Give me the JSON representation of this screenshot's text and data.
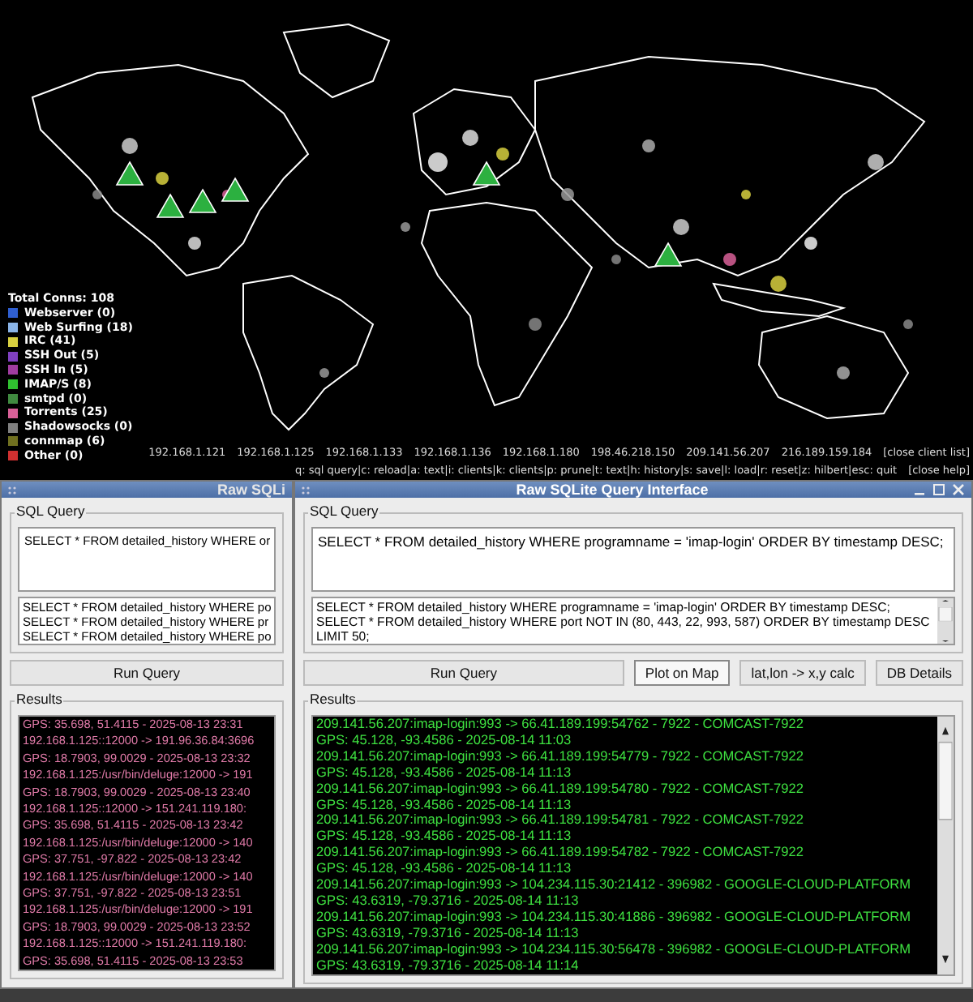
{
  "map": {
    "legend": {
      "total": "Total Conns: 108",
      "items": [
        {
          "label": "Webserver (0)",
          "color": "#2f5fd0"
        },
        {
          "label": "Web Surfing (18)",
          "color": "#8ab4e8"
        },
        {
          "label": "IRC (41)",
          "color": "#d8d040"
        },
        {
          "label": "SSH Out (5)",
          "color": "#8040c0"
        },
        {
          "label": "SSH In (5)",
          "color": "#a03ca0"
        },
        {
          "label": "IMAP/S (8)",
          "color": "#30c030"
        },
        {
          "label": "smtpd (0)",
          "color": "#408a40"
        },
        {
          "label": "Torrents (25)",
          "color": "#d86098"
        },
        {
          "label": "Shadowsocks (0)",
          "color": "#808080"
        },
        {
          "label": "connmap (6)",
          "color": "#707020"
        },
        {
          "label": "Other (0)",
          "color": "#d03030"
        }
      ]
    },
    "client_list": {
      "clients": [
        "192.168.1.121",
        "192.168.1.125",
        "192.168.1.133",
        "192.168.1.136",
        "192.168.1.180",
        "198.46.218.150",
        "209.141.56.207",
        "216.189.159.184"
      ],
      "close": "[close client list]"
    },
    "help_bar": {
      "text": "q: sql query|c: reload|a: text|i: clients|k: clients|p: prune|t: text|h: history|s: save|l: load|r: reset|z: hilbert|esc: quit",
      "close": "[close help]"
    }
  },
  "windows": [
    {
      "title": "Raw SQLi",
      "query_label": "SQL Query",
      "query": "SELECT * FROM detailed_history WHERE or",
      "history": [
        "SELECT * FROM detailed_history WHERE po",
        "SELECT * FROM detailed_history WHERE pr",
        "SELECT * FROM detailed_history WHERE po"
      ],
      "buttons": [
        {
          "label": "Run Query",
          "selected": false
        }
      ],
      "results_label": "Results",
      "results": [
        "GPS: 35.698, 51.4115 - 2025-08-13 23:31",
        "192.168.1.125::12000 -> 191.96.36.84:3696",
        "GPS: 18.7903, 99.0029 - 2025-08-13 23:32",
        "192.168.1.125:/usr/bin/deluge:12000 -> 191",
        "GPS: 18.7903, 99.0029 - 2025-08-13 23:40",
        "192.168.1.125::12000 -> 151.241.119.180:",
        "GPS: 35.698, 51.4115 - 2025-08-13 23:42",
        "192.168.1.125:/usr/bin/deluge:12000 -> 140",
        "GPS: 37.751, -97.822 - 2025-08-13 23:42",
        "192.168.1.125:/usr/bin/deluge:12000 -> 140",
        "GPS: 37.751, -97.822 - 2025-08-13 23:51",
        "192.168.1.125:/usr/bin/deluge:12000 -> 191",
        "GPS: 18.7903, 99.0029 - 2025-08-13 23:52",
        "192.168.1.125::12000 -> 151.241.119.180:",
        "GPS: 35.698, 51.4115 - 2025-08-13 23:53"
      ]
    },
    {
      "title": "Raw SQLite Query Interface",
      "query_label": "SQL Query",
      "query": "SELECT * FROM detailed_history WHERE programname = 'imap-login' ORDER BY timestamp DESC;",
      "history": [
        "SELECT * FROM detailed_history WHERE programname = 'imap-login' ORDER BY timestamp DESC;",
        "SELECT * FROM detailed_history WHERE port NOT IN (80, 443, 22, 993, 587) ORDER BY timestamp DESC LIMIT 50;"
      ],
      "buttons": [
        {
          "label": "Run Query",
          "selected": false
        },
        {
          "label": "Plot on Map",
          "selected": true
        },
        {
          "label": "lat,lon -> x,y calc",
          "selected": false
        },
        {
          "label": "DB Details",
          "selected": false
        }
      ],
      "results_label": "Results",
      "results": [
        "209.141.56.207:imap-login:993 -> 66.41.189.199:54762 - 7922 - COMCAST-7922",
        "GPS: 45.128, -93.4586 - 2025-08-14 11:03",
        "209.141.56.207:imap-login:993 -> 66.41.189.199:54779 - 7922 - COMCAST-7922",
        "GPS: 45.128, -93.4586 - 2025-08-14 11:13",
        "209.141.56.207:imap-login:993 -> 66.41.189.199:54780 - 7922 - COMCAST-7922",
        "GPS: 45.128, -93.4586 - 2025-08-14 11:13",
        "209.141.56.207:imap-login:993 -> 66.41.189.199:54781 - 7922 - COMCAST-7922",
        "GPS: 45.128, -93.4586 - 2025-08-14 11:13",
        "209.141.56.207:imap-login:993 -> 66.41.189.199:54782 - 7922 - COMCAST-7922",
        "GPS: 45.128, -93.4586 - 2025-08-14 11:13",
        "209.141.56.207:imap-login:993 -> 104.234.115.30:21412 - 396982 - GOOGLE-CLOUD-PLATFORM",
        "GPS: 43.6319, -79.3716 - 2025-08-14 11:13",
        "209.141.56.207:imap-login:993 -> 104.234.115.30:41886 - 396982 - GOOGLE-CLOUD-PLATFORM",
        "GPS: 43.6319, -79.3716 - 2025-08-14 11:13",
        "209.141.56.207:imap-login:993 -> 104.234.115.30:56478 - 396982 - GOOGLE-CLOUD-PLATFORM",
        "GPS: 43.6319, -79.3716 - 2025-08-14 11:14"
      ]
    }
  ]
}
